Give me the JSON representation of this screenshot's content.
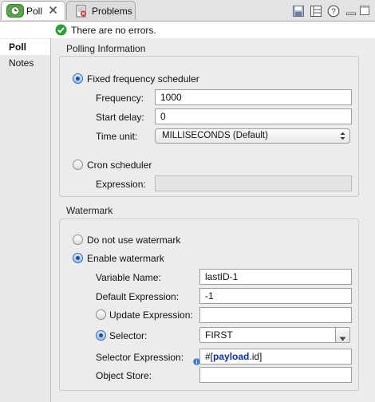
{
  "tabs": [
    {
      "label": "Poll",
      "icon": "poll-clock-icon",
      "active": true
    },
    {
      "label": "Problems",
      "icon": "problems-icon",
      "active": false
    }
  ],
  "toolbar_icons": [
    "save-icon",
    "layout-icon",
    "help-icon",
    "minimize-icon",
    "maximize-icon"
  ],
  "status": {
    "message": "There are no errors.",
    "icon": "check-circle-icon",
    "color": "#2e9e3a"
  },
  "nav": {
    "items": [
      {
        "label": "Poll"
      },
      {
        "label": "Notes"
      }
    ]
  },
  "polling": {
    "title": "Polling Information",
    "fixed": {
      "label": "Fixed frequency scheduler",
      "selected": true,
      "frequency": {
        "label": "Frequency:",
        "value": "1000"
      },
      "start_delay": {
        "label": "Start delay:",
        "value": "0"
      },
      "time_unit": {
        "label": "Time unit:",
        "value": "MILLISECONDS (Default)"
      }
    },
    "cron": {
      "label": "Cron scheduler",
      "selected": false,
      "expression": {
        "label": "Expression:",
        "value": ""
      }
    }
  },
  "watermark": {
    "title": "Watermark",
    "no_watermark": {
      "label": "Do not use watermark",
      "selected": false
    },
    "enable": {
      "label": "Enable watermark",
      "selected": true
    },
    "variable_name": {
      "label": "Variable Name:",
      "value": "lastID-1"
    },
    "default_expression": {
      "label": "Default Expression:",
      "value": "-1"
    },
    "update_expression": {
      "label": "Update Expression:",
      "value": "",
      "selected": false
    },
    "selector": {
      "label": "Selector:",
      "value": "FIRST",
      "selected": true
    },
    "selector_expression": {
      "label": "Selector Expression:",
      "prefix": "#[",
      "keyword": "payload",
      "suffix": ".id]"
    },
    "object_store": {
      "label": "Object Store:",
      "value": ""
    }
  },
  "colors": {
    "accent": "#3a68b4",
    "keyword": "#0b2f9e"
  }
}
